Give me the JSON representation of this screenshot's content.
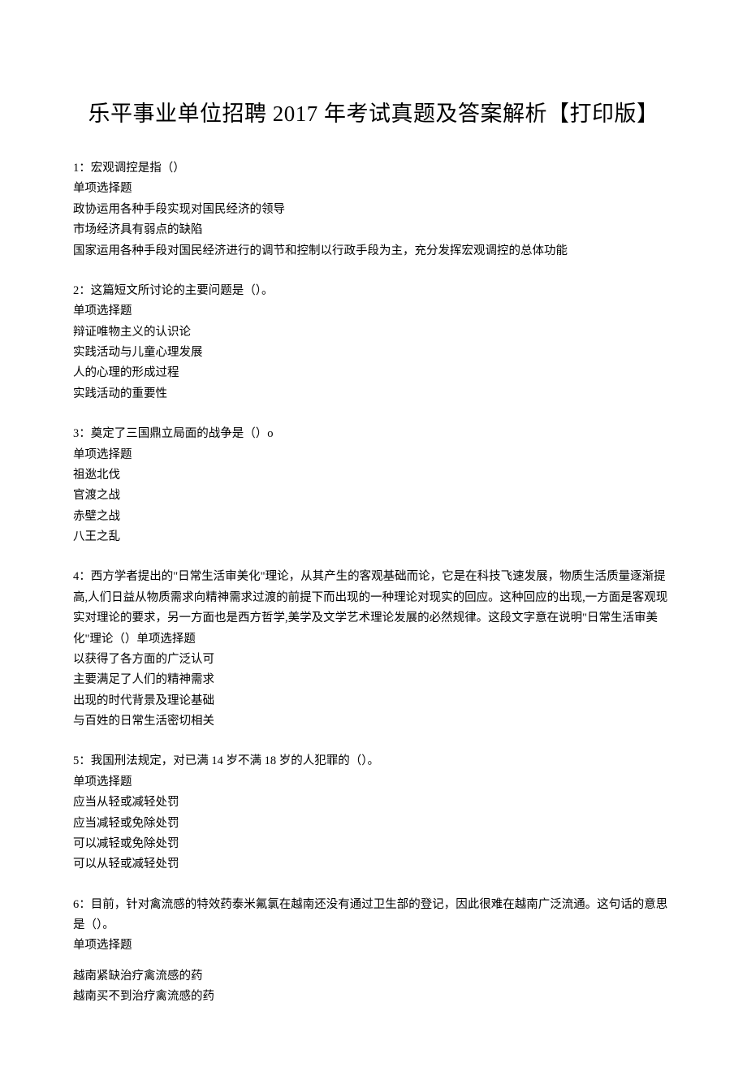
{
  "title": "乐平事业单位招聘 2017 年考试真题及答案解析【打印版】",
  "questions": [
    {
      "stem": "1：宏观调控是指（）",
      "type": "单项选择题",
      "options": [
        "政协运用各种手段实现对国民经济的领导",
        "市场经济具有弱点的缺陷",
        "国家运用各种手段对国民经济进行的调节和控制以行政手段为主，充分发挥宏观调控的总体功能"
      ]
    },
    {
      "stem": "2：这篇短文所讨论的主要问题是（）。",
      "type": "单项选择题",
      "options": [
        "辩证唯物主义的认识论",
        "实践活动与儿童心理发展",
        "人的心理的形成过程",
        "实践活动的重要性"
      ]
    },
    {
      "stem": "3：奠定了三国鼎立局面的战争是（）o",
      "type": "单项选择题",
      "options": [
        "祖逖北伐",
        "官渡之战",
        "赤壁之战",
        "八王之乱"
      ]
    },
    {
      "stem": "4：西方学者提出的\"日常生活审美化\"理论，从其产生的客观基础而论，它是在科技飞速发展，物质生活质量逐渐提高,人们日益从物质需求向精神需求过渡的前提下而出现的一种理论对现实的回应。这种回应的出现,一方面是客观现实对理论的要求，另一方面也是西方哲学,美学及文学艺术理论发展的必然规律。这段文字意在说明\"日常生活审美化\"理论（）单项选择题",
      "type": "",
      "options": [
        "以获得了各方面的广泛认可",
        "主要满足了人们的精神需求",
        "出现的时代背景及理论基础",
        "与百姓的日常生活密切相关"
      ]
    },
    {
      "stem": "5：我国刑法规定，对已满 14 岁不满 18 岁的人犯罪的（）。",
      "type": "单项选择题",
      "options": [
        "应当从轻或减轻处罚",
        "应当减轻或免除处罚",
        "可以减轻或免除处罚",
        "可以从轻或减轻处罚"
      ]
    },
    {
      "stem": "6：目前，针对禽流感的特效药泰米氟氯在越南还没有通过卫生部的登记，因此很难在越南广泛流通。这句话的意思是（）。",
      "type": "单项选择题",
      "options": [
        "越南紧缺治疗禽流感的药",
        "越南买不到治疗禽流感的药"
      ]
    }
  ]
}
